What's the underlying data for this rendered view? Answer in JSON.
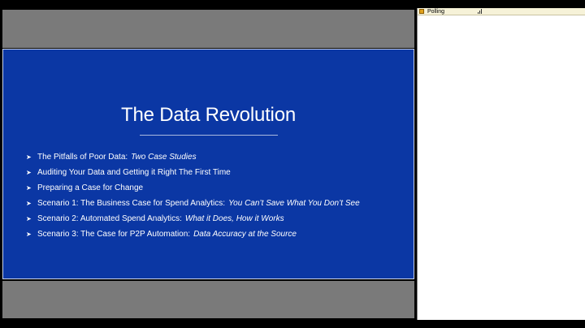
{
  "slide": {
    "title": "The Data Revolution",
    "bullets": [
      {
        "text": "The Pitfalls of Poor Data:",
        "emphasis": "Two Case Studies"
      },
      {
        "text": "Auditing Your Data and Getting it Right The First Time",
        "emphasis": ""
      },
      {
        "text": "Preparing a Case for Change",
        "emphasis": ""
      },
      {
        "text": "Scenario 1:  The Business Case for Spend Analytics:",
        "emphasis": "You Can’t Save What You Don’t See"
      },
      {
        "text": "Scenario 2:  Automated Spend Analytics:",
        "emphasis": "What it Does, How it Works"
      },
      {
        "text": "Scenario 3:  The Case for P2P Automation:",
        "emphasis": "Data Accuracy at the Source"
      }
    ],
    "bullet_icon": "arrow-bullet-icon",
    "background_color": "#0b37a4"
  },
  "panel": {
    "title": "Polling",
    "icons": [
      "drag-handle-icon",
      "signal-bars-icon"
    ]
  }
}
